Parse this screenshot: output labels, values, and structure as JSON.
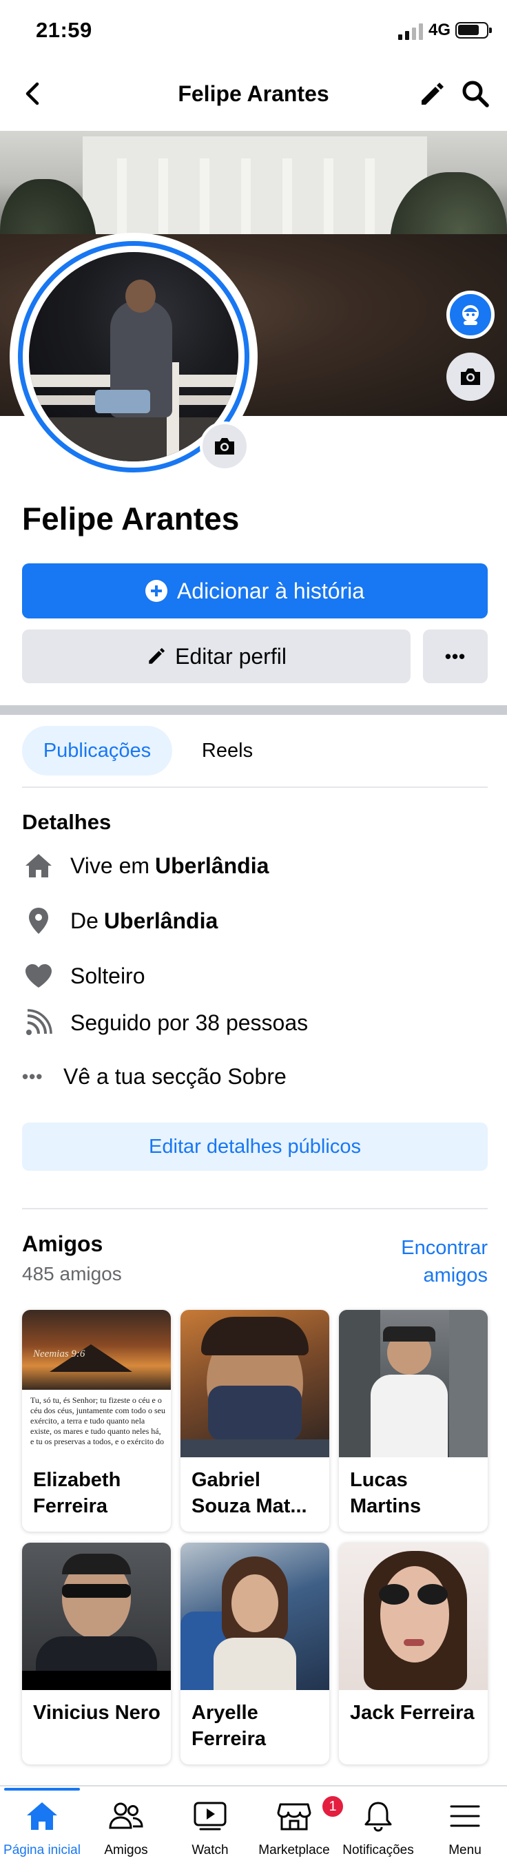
{
  "status_bar": {
    "time": "21:59",
    "network": "4G"
  },
  "header": {
    "title": "Felipe Arantes"
  },
  "profile": {
    "name": "Felipe Arantes",
    "add_story_label": "Adicionar à história",
    "edit_profile_label": "Editar perfil",
    "more_label": "•••"
  },
  "tabs": [
    {
      "label": "Publicações",
      "active": true
    },
    {
      "label": "Reels",
      "active": false
    }
  ],
  "details": {
    "title": "Detalhes",
    "items": [
      {
        "icon": "home-icon",
        "prefix": "Vive em",
        "value": "Uberlândia"
      },
      {
        "icon": "location-pin-icon",
        "prefix": "De",
        "value": "Uberlândia"
      },
      {
        "icon": "heart-icon",
        "prefix": "Solteiro",
        "value": ""
      },
      {
        "icon": "feed-icon",
        "prefix": "Seguido por 38 pessoas",
        "value": ""
      },
      {
        "icon": "more-dots-icon",
        "prefix": "Vê a tua secção Sobre",
        "value": ""
      }
    ],
    "edit_button_label": "Editar detalhes públicos"
  },
  "friends": {
    "title": "Amigos",
    "count": "485 amigos",
    "find_label": "Encontrar amigos",
    "cards": [
      {
        "name": "Elizabeth Ferreira",
        "photo_text": "Tu, só tu, és Senhor; tu fizeste o céu e o céu dos céus, juntamente com todo o seu exército, a terra e tudo quanto nela existe, os mares e tudo quanto neles há, e tu os preservas a todos, e o exército do",
        "photo_header": "Neemias 9:6"
      },
      {
        "name": "Gabriel Souza Mat..."
      },
      {
        "name": "Lucas Martins"
      },
      {
        "name": "Vinicius Nero"
      },
      {
        "name": "Aryelle Ferreira"
      },
      {
        "name": "Jack Ferreira"
      }
    ]
  },
  "bottom_nav": [
    {
      "label": "Página inicial",
      "icon": "home-icon",
      "active": true
    },
    {
      "label": "Amigos",
      "icon": "friends-icon",
      "active": false
    },
    {
      "label": "Watch",
      "icon": "watch-icon",
      "active": false
    },
    {
      "label": "Marketplace",
      "icon": "marketplace-icon",
      "active": false,
      "badge": "1"
    },
    {
      "label": "Notificações",
      "icon": "bell-icon",
      "active": false
    },
    {
      "label": "Menu",
      "icon": "menu-icon",
      "active": false
    }
  ],
  "colors": {
    "accent": "#1877f2",
    "secondary_bg": "#e4e6eb",
    "light_accent_bg": "#e7f3ff",
    "badge": "#e41e3f"
  }
}
